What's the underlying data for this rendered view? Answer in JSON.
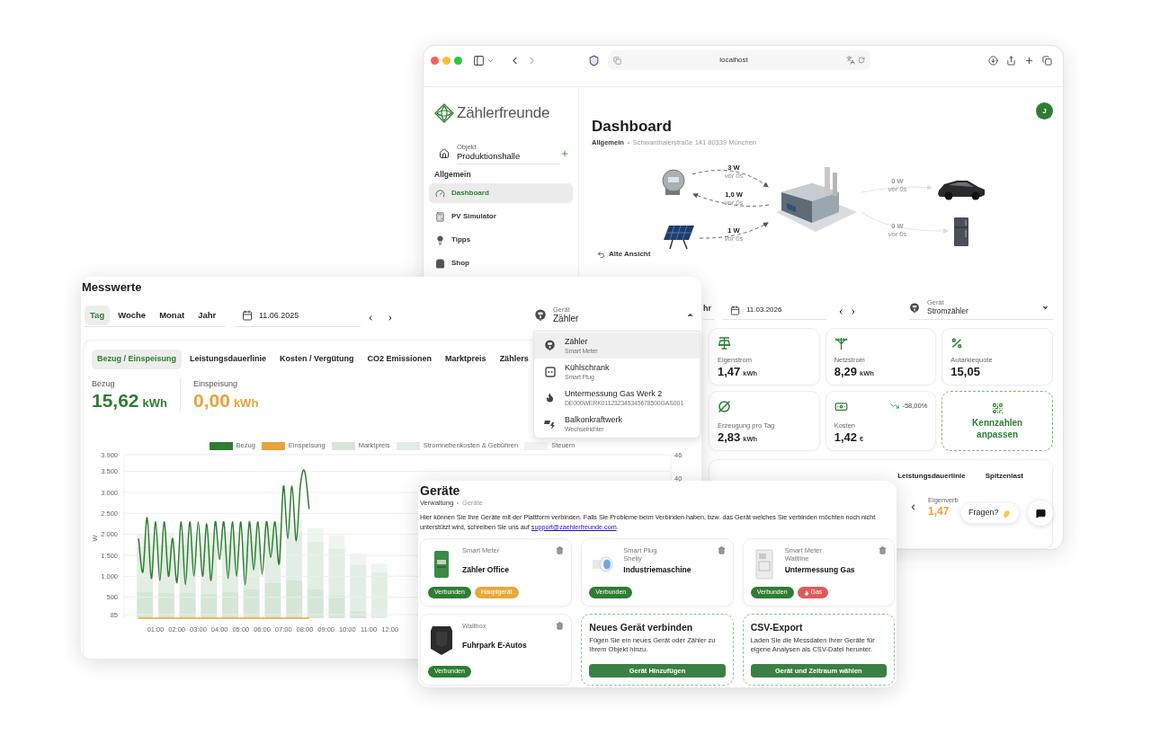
{
  "browser": {
    "address": "localhost"
  },
  "sidebar": {
    "brand": "Zählerfreunde",
    "object_label": "Objekt",
    "object_value": "Produktionshalle",
    "section": "Allgemein",
    "items": [
      {
        "label": "Dashboard",
        "kind": "gauge",
        "selected": true
      },
      {
        "label": "PV Simulator",
        "kind": "calculator",
        "selected": false
      },
      {
        "label": "Tipps",
        "kind": "bulb",
        "selected": false
      },
      {
        "label": "Shop",
        "kind": "bag",
        "selected": false
      }
    ]
  },
  "dashboard": {
    "avatar": "J",
    "title": "Dashboard",
    "breadcrumb": [
      "Allgemein",
      "Schwanthalerstraße 141 80339 München"
    ],
    "flows": [
      {
        "value": "3 W",
        "age": "vor 0s"
      },
      {
        "value": "1,0 W",
        "age": "vor 0s"
      },
      {
        "value": "1 W",
        "age": "vor 0s"
      },
      {
        "value": "0 W",
        "age": "vor 0s"
      },
      {
        "value": "0 W",
        "age": "vor 0s"
      }
    ],
    "old_view": "Alte Ansicht",
    "period_fragment": "hr",
    "date": "11.03.2026",
    "device_label": "Gerät",
    "device_value": "Stromzähler",
    "device_expanded": false,
    "stats": [
      {
        "kind": "solar",
        "label": "Eigenstrom",
        "value": "1,47",
        "unit": "kWh"
      },
      {
        "kind": "grid",
        "label": "Netzstrom",
        "value": "8,29",
        "unit": "kWh"
      },
      {
        "kind": "percent",
        "label": "Autarkiequote",
        "value": "15,05"
      },
      {
        "kind": "average",
        "label": "Erzeugung pro Tag",
        "value": "2,83",
        "unit": "kWh"
      },
      {
        "kind": "money",
        "label": "Kosten",
        "value": "1,42",
        "unit": "€",
        "trend": "-58,00%"
      }
    ],
    "customize": "Kennzahlen anpassen",
    "tabs": [
      {
        "label": "Leistungsdauerlinie",
        "selected": false
      },
      {
        "label": "Spitzenlast",
        "selected": false
      }
    ],
    "summary": {
      "label": "Eigenverb",
      "value": "1,47"
    },
    "help_button": "Fragen?"
  },
  "measurements": {
    "title": "Messwerte",
    "periods": [
      {
        "label": "Tag",
        "selected": true
      },
      {
        "label": "Woche",
        "selected": false
      },
      {
        "label": "Monat",
        "selected": false
      },
      {
        "label": "Jahr",
        "selected": false
      }
    ],
    "date": "11.06.2025",
    "device_label": "Gerät",
    "device_value": "Zähler",
    "device_expanded": true,
    "device_options": [
      {
        "name": "Zähler",
        "type": "Smart Meter",
        "kind": "meter",
        "selected": true
      },
      {
        "name": "Kühlschrank",
        "type": "Smart Plug",
        "kind": "plug",
        "selected": false
      },
      {
        "name": "Untermessung Gas Werk 2",
        "type": "DE000WERK011232345345678500GAS001",
        "kind": "flame",
        "selected": false
      },
      {
        "name": "Balkonkraftwerk",
        "type": "Wechselrichter",
        "kind": "inverter",
        "selected": false
      }
    ],
    "tabs": [
      {
        "label": "Bezug / Einspeisung",
        "selected": true
      },
      {
        "label": "Leistungsdauerlinie",
        "selected": false
      },
      {
        "label": "Kosten / Vergütung",
        "selected": false
      },
      {
        "label": "CO2 Emissionen",
        "selected": false
      },
      {
        "label": "Marktpreis",
        "selected": false
      },
      {
        "label": "Zählers",
        "selected": false
      }
    ],
    "totals": [
      {
        "label": "Bezug",
        "value": "15,62",
        "unit": "kWh",
        "color": "#2e7d32"
      },
      {
        "label": "Einspeisung",
        "value": "0,00",
        "unit": "kWh",
        "color": "#e8a33a"
      }
    ],
    "right_axis_labels": [
      "46",
      "40"
    ],
    "chart_data": {
      "type": "line",
      "grid": true,
      "ylabel": "W",
      "xlim": [
        -0.48,
        25.18
      ],
      "ylim": [
        0,
        3900
      ],
      "yticks": [
        {
          "value": 85,
          "label": "85"
        },
        {
          "value": 500,
          "label": "500"
        },
        {
          "value": 1000,
          "label": "1.000"
        },
        {
          "value": 1500,
          "label": "1.500"
        },
        {
          "value": 2000,
          "label": "2.000"
        },
        {
          "value": 2500,
          "label": "2.500"
        },
        {
          "value": 3000,
          "label": "3.000"
        },
        {
          "value": 3500,
          "label": "3.500"
        },
        {
          "value": 3900,
          "label": "3.900"
        }
      ],
      "xticks": [
        {
          "value": 1,
          "label": "01:00"
        },
        {
          "value": 2,
          "label": "02:00"
        },
        {
          "value": 3,
          "label": "03:00"
        },
        {
          "value": 4,
          "label": "04:00"
        },
        {
          "value": 5,
          "label": "05:00"
        },
        {
          "value": 6,
          "label": "06:00"
        },
        {
          "value": 7,
          "label": "07:00"
        },
        {
          "value": 8,
          "label": "08:00"
        },
        {
          "value": 9,
          "label": "09:00"
        },
        {
          "value": 10,
          "label": "10:00"
        },
        {
          "value": 11,
          "label": "11:00"
        },
        {
          "value": 12,
          "label": "12:00"
        }
      ],
      "x": [
        0.2,
        0.4,
        0.6,
        0.8,
        1.0,
        1.2,
        1.4,
        1.6,
        1.8,
        2.0,
        2.2,
        2.4,
        2.6,
        2.8,
        3.0,
        3.2,
        3.4,
        3.6,
        3.8,
        4.0,
        4.2,
        4.4,
        4.6,
        4.8,
        5.0,
        5.2,
        5.4,
        5.6,
        5.8,
        6.0,
        6.2,
        6.4,
        6.6,
        6.8,
        7.0,
        7.2,
        7.4,
        7.6,
        7.8,
        8.0,
        8.2
      ],
      "series": [
        {
          "name": "Bezug",
          "color": "#2e7d32",
          "values": [
            1900,
            1100,
            2400,
            950,
            2300,
            900,
            2300,
            1000,
            1900,
            850,
            2300,
            800,
            2300,
            1000,
            2300,
            1000,
            2250,
            900,
            2300,
            1400,
            2300,
            950,
            2300,
            1000,
            2300,
            800,
            2300,
            1150,
            2300,
            1050,
            2300,
            1450,
            2300,
            1300,
            3150,
            1900,
            3150,
            1850,
            3200,
            3500,
            2600
          ]
        },
        {
          "name": "Einspeisung",
          "color": "#e8a33a",
          "values": [
            0,
            0,
            0,
            0,
            0,
            0,
            0,
            0,
            0,
            0,
            0,
            0,
            0,
            0,
            0,
            0,
            0,
            0,
            0,
            0,
            0,
            0,
            0,
            0,
            0,
            0,
            0,
            0,
            0,
            0,
            0,
            0,
            0,
            0,
            0,
            0,
            0,
            0,
            0,
            0,
            0
          ]
        }
      ]
    },
    "price_bars": {
      "legend": [
        {
          "name": "Marktpreis",
          "color": "#d5e6d7"
        },
        {
          "name": "Stromnebenkosten & Gebühren",
          "color": "#e2eee3"
        },
        {
          "name": "Steuern",
          "color": "#eef5ee"
        }
      ]
    }
  },
  "devices": {
    "title": "Geräte",
    "breadcrumb": [
      "Verwaltung",
      "Geräte"
    ],
    "intro": "Hier können Sie Ihre Geräte mit der Plattform verbinden. Falls Sie Probleme beim Verbinden haben, bzw. das Gerät welches Sie verbinden möchten noch nicht unterstützt wird, schreiben Sie uns auf",
    "link": "support@zaehlerfreunde.com",
    "intro_end": ".",
    "cards": [
      {
        "kind": "meter_green",
        "type": "Smart Meter",
        "name": "Zähler Office",
        "badges": [
          {
            "label": "Verbunden",
            "kind": "plain",
            "color": "#2e7d32"
          },
          {
            "label": "Hauptgerät",
            "kind": "plain",
            "color": "#e8a838"
          }
        ]
      },
      {
        "kind": "plug",
        "type": "Smart Plug",
        "vendor": "Shelly",
        "name": "Industriemaschine",
        "badges": [
          {
            "label": "Verbunden",
            "kind": "plain",
            "color": "#2e7d32"
          }
        ]
      },
      {
        "kind": "meter_cabinet",
        "type": "Smart Meter",
        "vendor": "Wattline",
        "name": "Untermessung Gas",
        "badges": [
          {
            "label": "Verbunden",
            "kind": "plain",
            "color": "#2e7d32"
          },
          {
            "label": "Gas",
            "kind": "flame",
            "color": "#e05a5a"
          }
        ]
      },
      {
        "kind": "wallbox",
        "type": "Wallbox",
        "name": "Fuhrpark E-Autos",
        "badges": [
          {
            "label": "Verbunden",
            "kind": "plain",
            "color": "#2e7d32"
          }
        ]
      }
    ],
    "actions": [
      {
        "title": "Neues Gerät verbinden",
        "text": "Fügen Sie ein neues Gerät oder Zähler zu Ihrem Objekt hinzu.",
        "button": "Gerät Hinzufügen"
      },
      {
        "title": "CSV-Export",
        "text": "Laden Sie die Messdaten Ihrer Geräte für eigene Analysen als CSV-Datei herunter.",
        "button": "Gerät und Zeitraum wählen"
      }
    ]
  }
}
